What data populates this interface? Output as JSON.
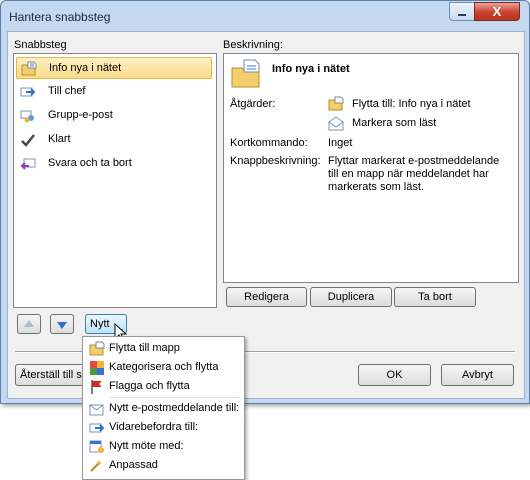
{
  "window": {
    "title": "Hantera snabbsteg",
    "close_label": "X"
  },
  "list_section": {
    "label": "Snabbsteg"
  },
  "quicksteps": [
    {
      "label": "Info nya i nätet",
      "icon": "folder-move-icon",
      "selected": true
    },
    {
      "label": "Till chef",
      "icon": "forward-arrow-icon"
    },
    {
      "label": "Grupp-e-post",
      "icon": "group-mail-icon"
    },
    {
      "label": "Klart",
      "icon": "checkmark-icon"
    },
    {
      "label": "Svara och ta bort",
      "icon": "reply-delete-icon"
    }
  ],
  "description": {
    "label": "Beskrivning:",
    "title": "Info nya i nätet",
    "actions_label": "Åtgärder:",
    "actions": [
      {
        "label": "Flytta till: Info nya i nätet",
        "icon": "folder-move-icon"
      },
      {
        "label": "Markera som läst",
        "icon": "envelope-open-icon"
      }
    ],
    "shortcut_label": "Kortkommando:",
    "shortcut_value": "Inget",
    "tooltip_label": "Knappbeskrivning:",
    "tooltip_lines": [
      "Flyttar markerat e-postmeddelande",
      "till en mapp när meddelandet har",
      "markerats som läst."
    ]
  },
  "buttons": {
    "edit": "Redigera",
    "duplicate": "Duplicera",
    "delete": "Ta bort",
    "new": "Nytt",
    "reset": "Återställ till s",
    "ok": "OK",
    "cancel": "Avbryt"
  },
  "new_menu": [
    {
      "label": "Flytta till mapp",
      "icon": "folder-move-icon"
    },
    {
      "label": "Kategorisera och flytta",
      "icon": "categorize-icon"
    },
    {
      "label": "Flagga och flytta",
      "icon": "flag-icon"
    },
    {
      "label": "Nytt e-postmeddelande till:",
      "icon": "new-mail-icon"
    },
    {
      "label": "Vidarebefordra till:",
      "icon": "forward-icon"
    },
    {
      "label": "Nytt möte med:",
      "icon": "meeting-icon"
    },
    {
      "label": "Anpassad",
      "icon": "custom-icon"
    }
  ],
  "colors": {
    "selection": "#f9dc8a",
    "titlebar": "#c4d9ef",
    "close": "#c9422f"
  }
}
